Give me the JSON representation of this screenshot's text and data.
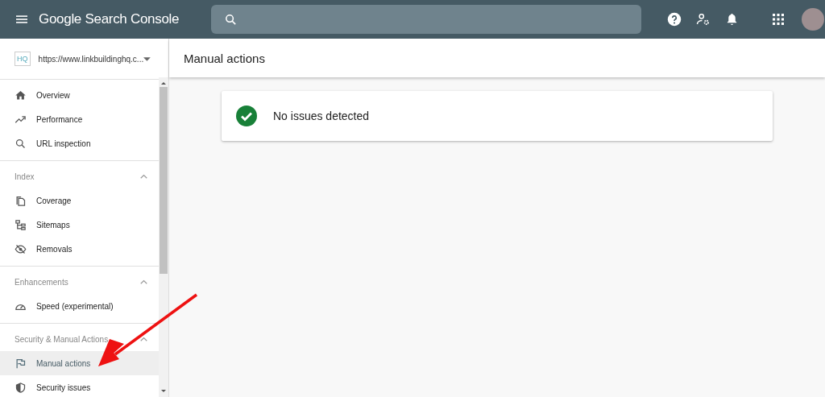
{
  "header": {
    "title": "Google Search Console"
  },
  "property": {
    "url": "https://www.linkbuildinghq.c...",
    "logo": "HQ"
  },
  "sidebar": {
    "top_items": [
      {
        "label": "Overview",
        "selected": false
      },
      {
        "label": "Performance",
        "selected": false
      },
      {
        "label": "URL inspection",
        "selected": false
      }
    ],
    "sections": [
      {
        "title": "Index",
        "expanded": true,
        "items": [
          {
            "label": "Coverage",
            "selected": false
          },
          {
            "label": "Sitemaps",
            "selected": false
          },
          {
            "label": "Removals",
            "selected": false
          }
        ]
      },
      {
        "title": "Enhancements",
        "expanded": true,
        "items": [
          {
            "label": "Speed (experimental)",
            "selected": false
          }
        ]
      },
      {
        "title": "Security & Manual Actions",
        "expanded": true,
        "items": [
          {
            "label": "Manual actions",
            "selected": true
          },
          {
            "label": "Security issues",
            "selected": false
          }
        ]
      }
    ]
  },
  "page": {
    "title": "Manual actions",
    "status": {
      "text": "No issues detected",
      "ok": true
    }
  }
}
